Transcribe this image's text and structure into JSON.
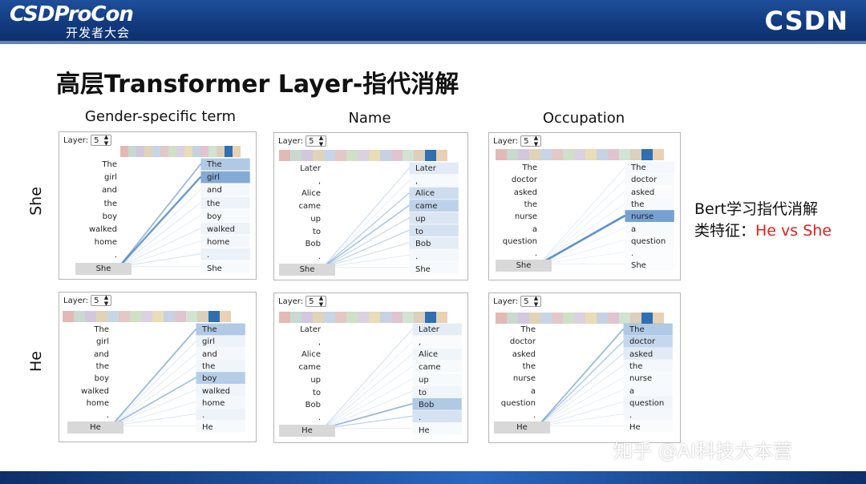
{
  "banner": {
    "logo_main": "CSDProCon",
    "logo_sub": "开发者大会",
    "logo_right": "CSDN"
  },
  "slide": {
    "title": "高层Transformer Layer-指代消解",
    "columns": [
      "Gender-specific term",
      "Name",
      "Occupation"
    ],
    "rows": [
      "She",
      "He"
    ],
    "note_line1": "Bert学习指代消解",
    "note_line2_prefix": "类特征：",
    "note_line2_accent": "He vs She"
  },
  "layer_label": "Layer:",
  "layer_value": "5",
  "head_colors": [
    "#e3b9b5",
    "#c9d9cf",
    "#d2c7dd",
    "#e1d3b8",
    "#c7d6e6",
    "#e4c7c7",
    "#cfe0c7",
    "#dcd1e0",
    "#e9dcb6",
    "#c6d2e3",
    "#e0c4cf",
    "#d1e3d3",
    "#dbd0bd",
    "#2f6fb2",
    "#e9d1b3"
  ],
  "colors": {
    "accent_red": "#e02020",
    "link_strong": "#3e7bbf",
    "link_weak": "#b9cde6"
  },
  "panels": [
    {
      "left": [
        "The",
        "girl",
        "and",
        "the",
        "boy",
        "walked",
        "home",
        ".",
        "She"
      ],
      "right": [
        "The",
        "girl",
        "and",
        "the",
        "boy",
        "walked",
        "home",
        ".",
        "She"
      ],
      "query": 8,
      "attention": [
        0.55,
        0.85,
        0.08,
        0.12,
        0.05,
        0.12,
        0.08,
        0.15,
        0.05
      ]
    },
    {
      "left": [
        "Later",
        ",",
        "Alice",
        "came",
        "up",
        "to",
        "Bob",
        ".",
        "She"
      ],
      "right": [
        "Later",
        ",",
        "Alice",
        "came",
        "up",
        "to",
        "Bob",
        ".",
        "She"
      ],
      "query": 8,
      "attention": [
        0.2,
        0.05,
        0.35,
        0.45,
        0.25,
        0.3,
        0.18,
        0.08,
        0.05
      ]
    },
    {
      "left": [
        "The",
        "doctor",
        "asked",
        "the",
        "nurse",
        "a",
        "question",
        ".",
        "She"
      ],
      "right": [
        "The",
        "doctor",
        "asked",
        "the",
        "nurse",
        "a",
        "question",
        ".",
        "She"
      ],
      "query": 8,
      "attention": [
        0.08,
        0.05,
        0.04,
        0.06,
        0.95,
        0.05,
        0.04,
        0.03,
        0.03
      ]
    },
    {
      "left": [
        "The",
        "girl",
        "and",
        "the",
        "boy",
        "walked",
        "home",
        ".",
        "He"
      ],
      "right": [
        "The",
        "girl",
        "and",
        "the",
        "boy",
        "walked",
        "home",
        ".",
        "He"
      ],
      "query": 8,
      "attention": [
        0.55,
        0.12,
        0.08,
        0.1,
        0.5,
        0.1,
        0.08,
        0.12,
        0.05
      ]
    },
    {
      "left": [
        "Later",
        ",",
        "Alice",
        "came",
        "up",
        "to",
        "Bob",
        ".",
        "He"
      ],
      "right": [
        "Later",
        ",",
        "Alice",
        "came",
        "up",
        "to",
        "Bob",
        ".",
        "He"
      ],
      "query": 8,
      "attention": [
        0.18,
        0.04,
        0.1,
        0.06,
        0.05,
        0.1,
        0.55,
        0.3,
        0.05
      ]
    },
    {
      "left": [
        "The",
        "doctor",
        "asked",
        "the",
        "nurse",
        "a",
        "question",
        ".",
        "He"
      ],
      "right": [
        "The",
        "doctor",
        "asked",
        "the",
        "nurse",
        "a",
        "question",
        ".",
        "He"
      ],
      "query": 8,
      "attention": [
        0.55,
        0.4,
        0.2,
        0.08,
        0.06,
        0.05,
        0.1,
        0.08,
        0.04
      ]
    }
  ],
  "watermark": "知乎 @AI科技大本营"
}
